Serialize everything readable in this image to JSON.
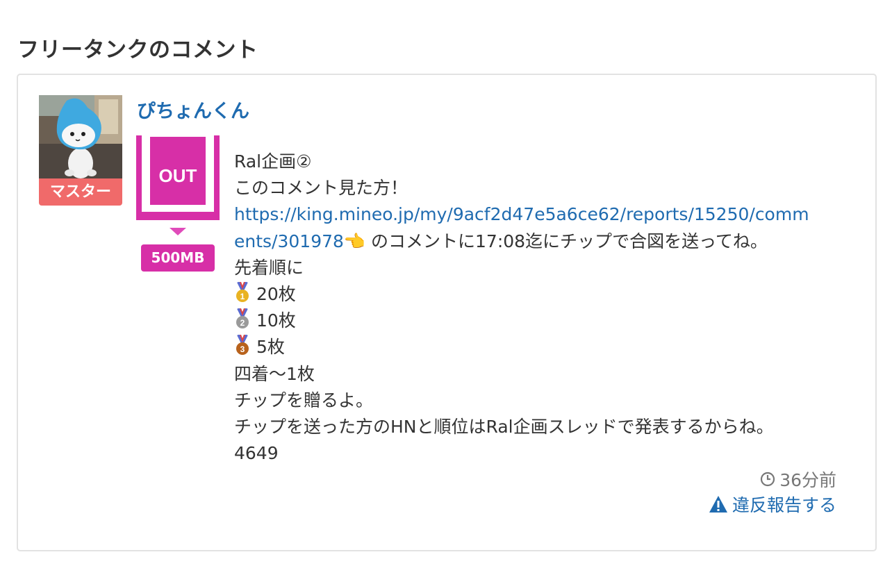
{
  "page": {
    "section_title": "フリータンクのコメント"
  },
  "comment": {
    "avatar_icon": "mascot-photo",
    "user_badge": "マスター",
    "username": "ぴちょんくん",
    "tank_action": "OUT",
    "tank_amount": "500MB",
    "text": {
      "line1": "Ral企画②",
      "line2": "このコメント見た方！",
      "link_part1": "https://king.mineo.jp/my/9acf2d47e5a6ce62/reports/15250/comm",
      "link_part2": "ents/301978",
      "pointing_emoji": "👈",
      "line4_rest": "のコメントに17:08迄にチップで合図を送ってね。",
      "line5": "先着順に",
      "rank1": "20枚",
      "rank2": "10枚",
      "rank3": "5枚",
      "line9": "四着〜1枚",
      "line10": "チップを贈るよ。",
      "line11": "チップを送った方のHNと順位はRal企画スレッドで発表するからね。",
      "line12": "4649"
    },
    "time_icon": "clock-icon",
    "time_label": "36分前",
    "report_icon": "warning-icon",
    "report_label": "違反報告する"
  },
  "colors": {
    "accent_link": "#1f6bb0",
    "master_badge": "#f06a6a",
    "tank_magenta": "#d72fa7",
    "text": "#333333",
    "muted": "#777777"
  }
}
